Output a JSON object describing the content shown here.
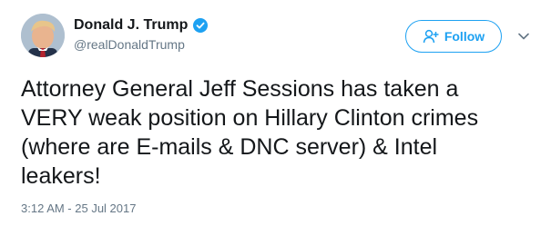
{
  "author": {
    "display_name": "Donald J. Trump",
    "handle": "@realDonaldTrump",
    "verified": true
  },
  "actions": {
    "follow_label": "Follow",
    "follow_icon": "add-user-icon",
    "more_icon": "chevron-down-icon"
  },
  "tweet": {
    "text": "Attorney General Jeff Sessions has taken a\nVERY weak position on Hillary Clinton crimes\n(where are E-mails & DNC server) & Intel\nleakers!",
    "timestamp": "3:12 AM - 25 Jul 2017"
  },
  "colors": {
    "accent": "#1da1f2",
    "text": "#14171a",
    "secondary": "#657786"
  }
}
